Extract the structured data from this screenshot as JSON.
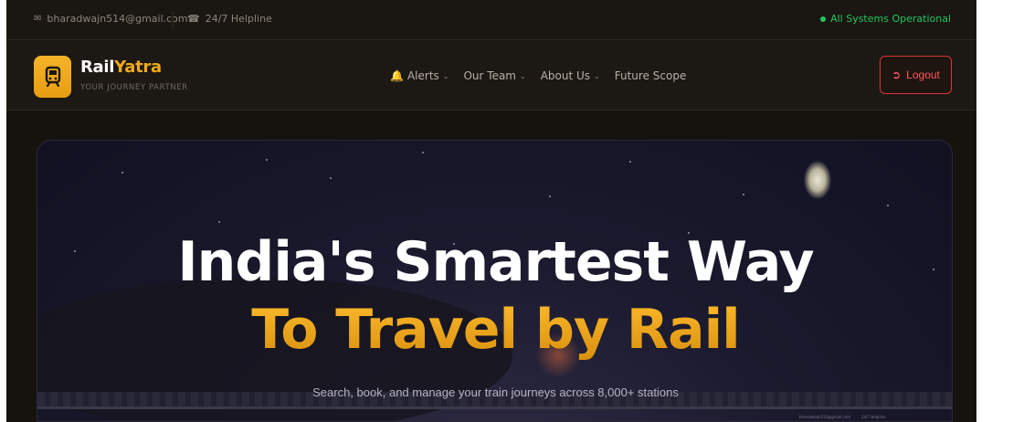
{
  "topbar": {
    "email": "bharadwajn514@gmail.com",
    "phone": "24/7 Helpline",
    "status": "All Systems Operational",
    "icons": {
      "email": "mail-icon",
      "phone": "phone-icon",
      "status": "status-dot-icon"
    }
  },
  "brand": {
    "name_part1": "Rail",
    "name_part2": "Yatra",
    "tagline": "YOUR JOURNEY PARTNER",
    "logo_icon": "train-icon"
  },
  "nav": {
    "items": [
      {
        "label": "Alerts",
        "icon": "bell-icon",
        "has_dropdown": true
      },
      {
        "label": "Our Team",
        "has_dropdown": true
      },
      {
        "label": "About Us",
        "has_dropdown": true
      },
      {
        "label": "Future Scope",
        "has_dropdown": false
      }
    ],
    "logout_label": "Logout",
    "logout_icon": "logout-icon"
  },
  "hero": {
    "title_line1": "India's Smartest Way",
    "title_line2": "To Travel by Rail",
    "subtitle": "Search, book, and manage your train journeys across 8,000+ stations"
  },
  "mini_footer": {
    "email": "bharadwajn514@gmail.com",
    "phone": "24/7 Helpline"
  },
  "colors": {
    "accent": "#f0a91d",
    "background": "#16130f",
    "status_green": "#22c55e",
    "logout_red": "#d63939"
  }
}
